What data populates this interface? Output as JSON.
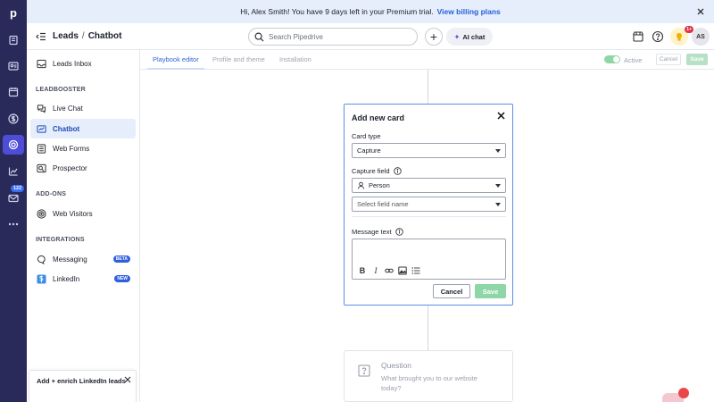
{
  "banner": {
    "text": "Hi, Alex Smith! You have 9 days left in your Premium trial.",
    "link": "View billing plans"
  },
  "rail": {
    "logo": "p",
    "mail_badge": "122"
  },
  "header": {
    "crumb_parent": "Leads",
    "crumb_sep": "/",
    "crumb_current": "Chatbot",
    "search_placeholder": "Search Pipedrive",
    "plus": "+",
    "ai_chat": "AI chat",
    "notif_count": "1+",
    "avatar": "AS"
  },
  "sidebar": {
    "inbox": "Leads Inbox",
    "section_leadbooster": "LEADBOOSTER",
    "live_chat": "Live Chat",
    "chatbot": "Chatbot",
    "web_forms": "Web Forms",
    "prospector": "Prospector",
    "section_addons": "ADD-ONS",
    "web_visitors": "Web Visitors",
    "section_integrations": "INTEGRATIONS",
    "messaging": "Messaging",
    "messaging_badge": "BETA",
    "linkedin": "LinkedIn",
    "linkedin_badge": "NEW",
    "promo": "Add + enrich LinkedIn leads"
  },
  "tabs": {
    "playbook": "Playbook editor",
    "profile": "Profile and theme",
    "installation": "Installation",
    "active_label": "Active",
    "cancel": "Cancel",
    "save": "Save"
  },
  "modal": {
    "title": "Add new card",
    "card_type_label": "Card type",
    "card_type_value": "Capture",
    "capture_field_label": "Capture field",
    "capture_field_value": "Person",
    "field_name_placeholder": "Select field name",
    "message_text_label": "Message text",
    "cancel": "Cancel",
    "save": "Save"
  },
  "question_card": {
    "title": "Question",
    "text": "What brought you to our website today?"
  },
  "colors": {
    "rail": "#2a2a5a",
    "rail_active": "#4d4dd8",
    "accent_blue": "#2e68d6",
    "save_green": "#8fd6a6"
  }
}
